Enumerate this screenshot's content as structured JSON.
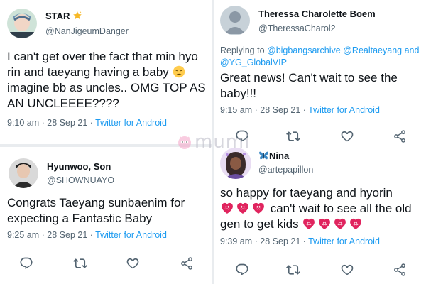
{
  "colors": {
    "link": "#1d9bf0",
    "secondary_text": "#536471",
    "primary_text": "#0f1419"
  },
  "watermark": {
    "text": "mumi"
  },
  "tweets": [
    {
      "name": "STAR",
      "name_emoji": "star-emoji-icon",
      "handle": "@NanJigeumDanger",
      "text_before_emoji": "I can't get over the fact that min hyo rin and taeyang having a baby",
      "text_emoji": "tired-face-emoji-icon",
      "text_after_emoji": " imagine bb as uncles.. OMG TOP AS AN UNCLEEEE????",
      "time": "9:10 am · 28 Sep 21 · ",
      "source": "Twitter for Android"
    },
    {
      "name": "Hyunwoo, Son",
      "handle": "@SHOWNUAYO",
      "text": "Congrats Taeyang sunbaenim for expecting a Fantastic Baby",
      "time": "9:25 am · 28 Sep 21 · ",
      "source": "Twitter for Android",
      "actions": [
        "reply-icon",
        "retweet-icon",
        "like-icon",
        "share-icon"
      ]
    },
    {
      "name": "Theressa Charolette Boem",
      "handle": "@TheressaCharol2",
      "reply_prefix": "Replying to ",
      "reply_links": [
        "@bigbangsarchive",
        "@Realtaeyang",
        "and"
      ],
      "reply_link_last": "@YG_GlobalVIP",
      "text": "Great news! Can't wait to see the baby!!!",
      "time": "9:15 am · 28 Sep 21 · ",
      "source": "Twitter for Android",
      "actions": [
        "reply-icon",
        "retweet-icon",
        "like-icon",
        "share-icon"
      ]
    },
    {
      "name_emoji": "butterfly-emoji-icon",
      "name": "Nina",
      "handle": "@artepapillon",
      "text_line1": "so happy for taeyang and hyorin",
      "text_mid": " can't wait to see all the old gen to get kids ",
      "hearts_before": 3,
      "hearts_after": 4,
      "time": "9:39 am · 28 Sep 21 · ",
      "source": "Twitter for Android",
      "actions": [
        "reply-icon",
        "retweet-icon",
        "like-icon",
        "share-icon"
      ]
    }
  ]
}
